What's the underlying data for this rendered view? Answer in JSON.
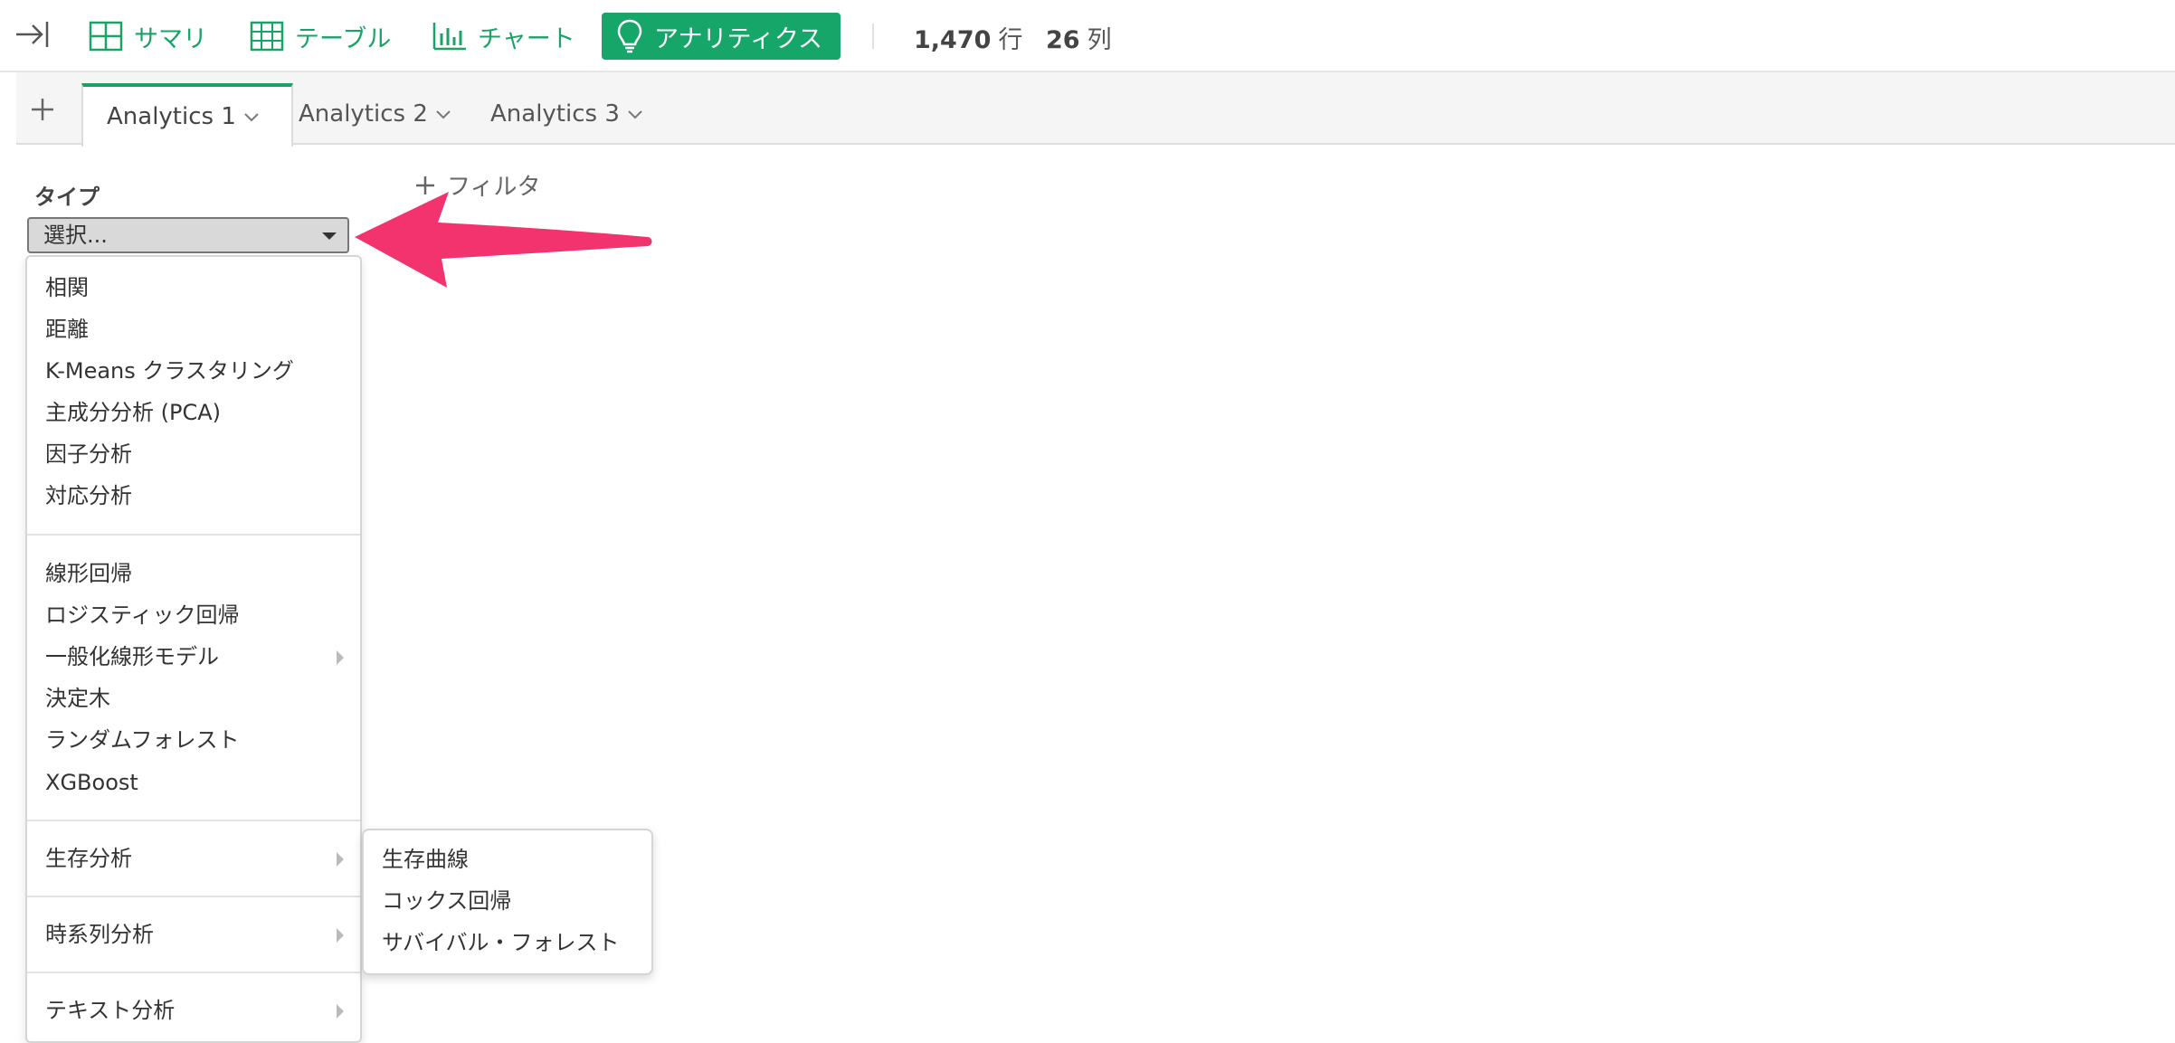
{
  "toolbar": {
    "summary_label": "サマリ",
    "table_label": "テーブル",
    "chart_label": "チャート",
    "analytics_label": "アナリティクス",
    "rows_count": "1,470",
    "rows_unit": "行",
    "cols_count": "26",
    "cols_unit": "列"
  },
  "tabs": [
    {
      "label": "Analytics 1",
      "active": true
    },
    {
      "label": "Analytics 2",
      "active": false
    },
    {
      "label": "Analytics 3",
      "active": false
    }
  ],
  "panel": {
    "type_label": "タイプ",
    "select_value": "選択...",
    "filter_label": "フィルタ"
  },
  "menu": {
    "items": [
      {
        "label": "相関",
        "has_submenu": false
      },
      {
        "label": "距離",
        "has_submenu": false
      },
      {
        "label": "K-Means クラスタリング",
        "has_submenu": false
      },
      {
        "label": "主成分分析 (PCA)",
        "has_submenu": false
      },
      {
        "label": "因子分析",
        "has_submenu": false
      },
      {
        "label": "対応分析",
        "has_submenu": false
      },
      {
        "label": "線形回帰",
        "has_submenu": false
      },
      {
        "label": "ロジスティック回帰",
        "has_submenu": false
      },
      {
        "label": "一般化線形モデル",
        "has_submenu": true
      },
      {
        "label": "決定木",
        "has_submenu": false
      },
      {
        "label": "ランダムフォレスト",
        "has_submenu": false
      },
      {
        "label": "XGBoost",
        "has_submenu": false
      },
      {
        "label": "生存分析",
        "has_submenu": true
      },
      {
        "label": "時系列分析",
        "has_submenu": true
      },
      {
        "label": "テキスト分析",
        "has_submenu": true
      }
    ]
  },
  "submenu": {
    "items": [
      {
        "label": "生存曲線"
      },
      {
        "label": "コックス回帰"
      },
      {
        "label": "サバイバル・フォレスト"
      }
    ]
  },
  "colors": {
    "accent": "#1aa366",
    "accent_active_bg": "#17a66a",
    "annotation_arrow": "#f2336e"
  }
}
